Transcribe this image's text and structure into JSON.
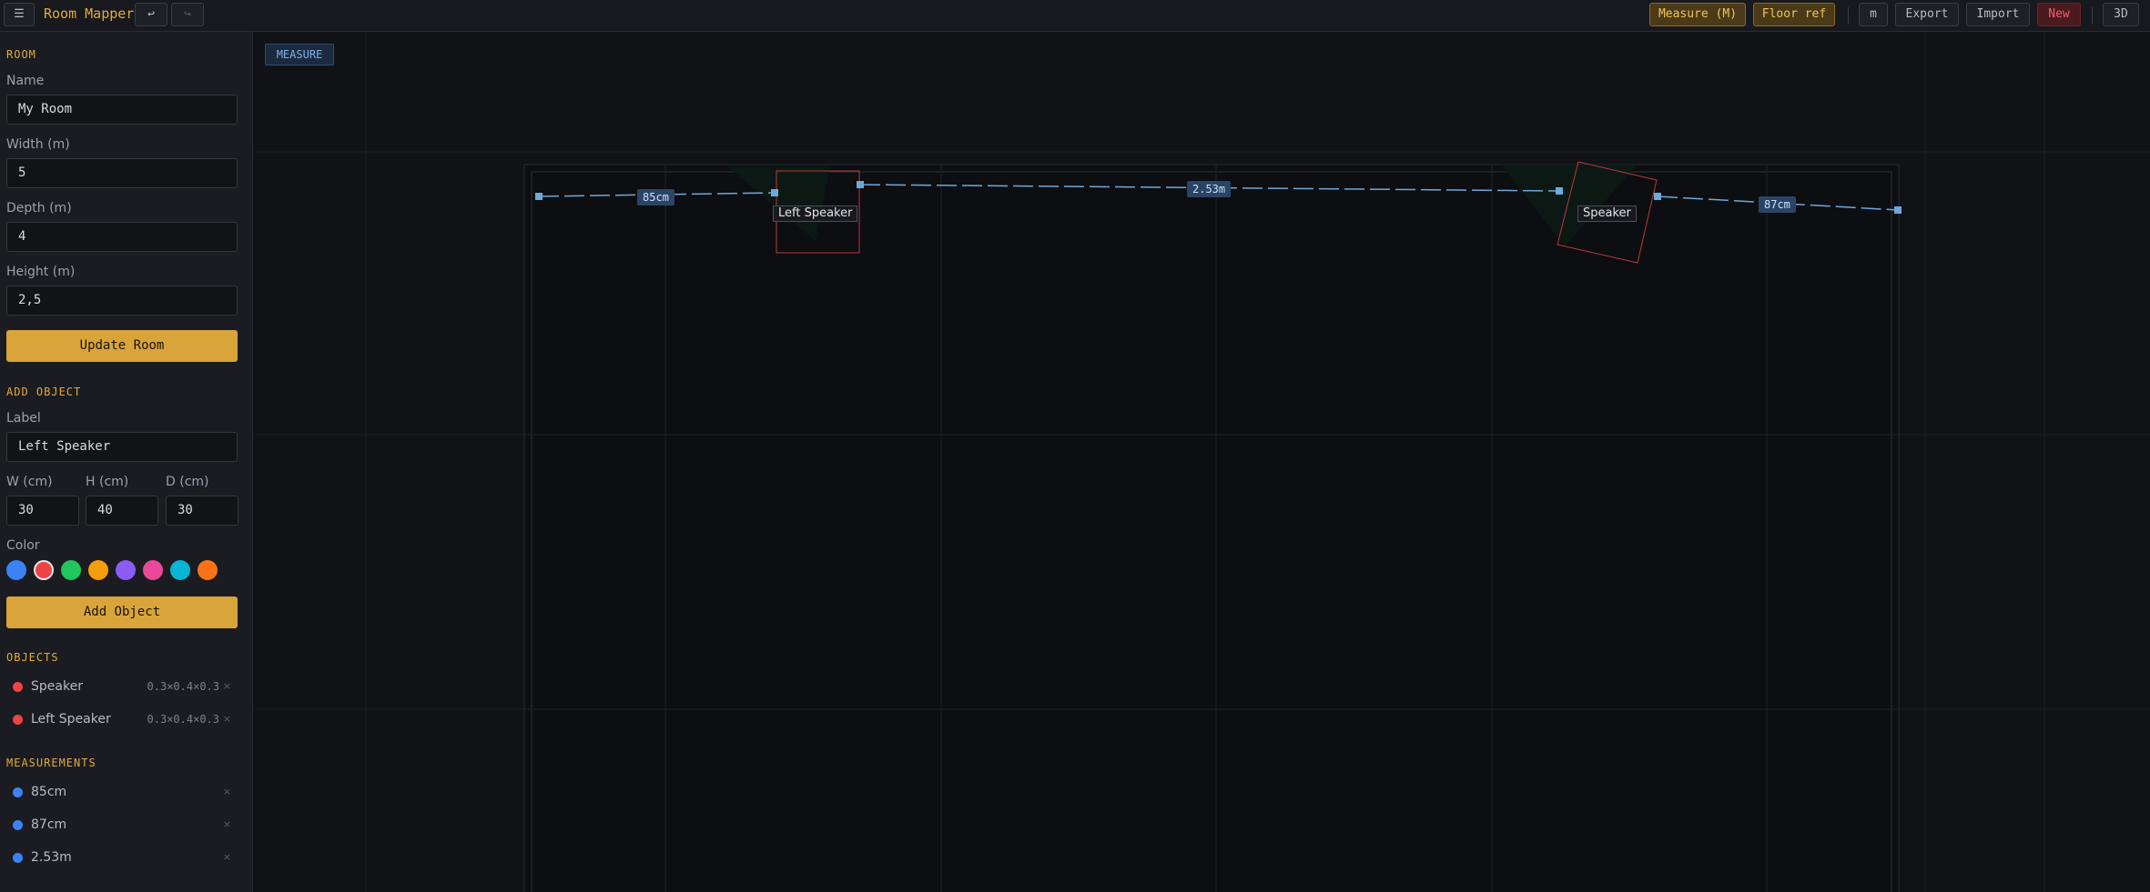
{
  "topbar": {
    "menu_icon": "hamburger-icon",
    "title": "Room Mapper",
    "undo_icon": "undo-icon",
    "redo_icon": "redo-icon",
    "measure_label": "Measure (M)",
    "floor_ref_label": "Floor ref",
    "unit_label": "m",
    "export_label": "Export",
    "import_label": "Import",
    "new_label": "New",
    "view_3d_label": "3D"
  },
  "sidebar": {
    "room": {
      "heading": "ROOM",
      "name_label": "Name",
      "name_value": "My Room",
      "width_label": "Width (m)",
      "width_value": "5",
      "depth_label": "Depth (m)",
      "depth_value": "4",
      "height_label": "Height (m)",
      "height_value": "2,5",
      "update_label": "Update Room"
    },
    "add_object": {
      "heading": "ADD OBJECT",
      "label_label": "Label",
      "label_value": "Left Speaker",
      "w_label": "W (cm)",
      "w_value": "30",
      "h_label": "H (cm)",
      "h_value": "40",
      "d_label": "D (cm)",
      "d_value": "30",
      "color_label": "Color",
      "colors": [
        "#3b82f6",
        "#ef4444",
        "#22c55e",
        "#f59e0b",
        "#8b5cf6",
        "#ec4899",
        "#06b6d4",
        "#f97316"
      ],
      "selected_color": "#ef4444",
      "add_label": "Add Object"
    },
    "objects": {
      "heading": "OBJECTS",
      "items": [
        {
          "name": "Speaker",
          "dims": "0.3×0.4×0.3",
          "color": "#ef4444",
          "remove": "×"
        },
        {
          "name": "Left Speaker",
          "dims": "0.3×0.4×0.3",
          "color": "#ef4444",
          "remove": "×"
        }
      ]
    },
    "measurements": {
      "heading": "MEASUREMENTS",
      "items": [
        {
          "name": "85cm",
          "color": "#3b82f6",
          "remove": "×"
        },
        {
          "name": "87cm",
          "color": "#3b82f6",
          "remove": "×"
        },
        {
          "name": "2.53m",
          "color": "#3b82f6",
          "remove": "×"
        }
      ]
    }
  },
  "canvas": {
    "mode_badge": "MEASURE",
    "objects": [
      {
        "label": "Left Speaker",
        "color": "#ef4444"
      },
      {
        "label": "Speaker",
        "color": "#ef4444"
      }
    ],
    "measurements": [
      {
        "label": "85cm"
      },
      {
        "label": "2.53m"
      },
      {
        "label": "87cm"
      }
    ],
    "line_color": "#6fa8dc"
  }
}
